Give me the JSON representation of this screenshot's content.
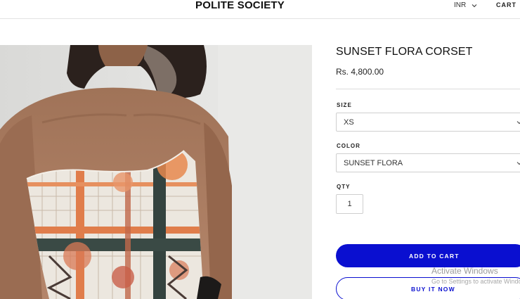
{
  "header": {
    "brand": "POLITE SOCIETY",
    "currency": "INR",
    "cart_label": "CART"
  },
  "product": {
    "title": "SUNSET FLORA CORSET",
    "price": "Rs. 4,800.00",
    "size": {
      "label": "SIZE",
      "selected": "XS"
    },
    "color": {
      "label": "COLOR",
      "selected": "SUNSET FLORA"
    },
    "qty": {
      "label": "QTY",
      "value": "1"
    },
    "add_to_cart_label": "ADD TO CART",
    "buy_now_label": "BUY IT NOW"
  },
  "activation_watermark": {
    "title": "Activate Windows",
    "subtitle": "Go to Settings to activate Windows."
  },
  "colors": {
    "accent": "#0a0fd0",
    "divider": "#dcdcdc"
  }
}
